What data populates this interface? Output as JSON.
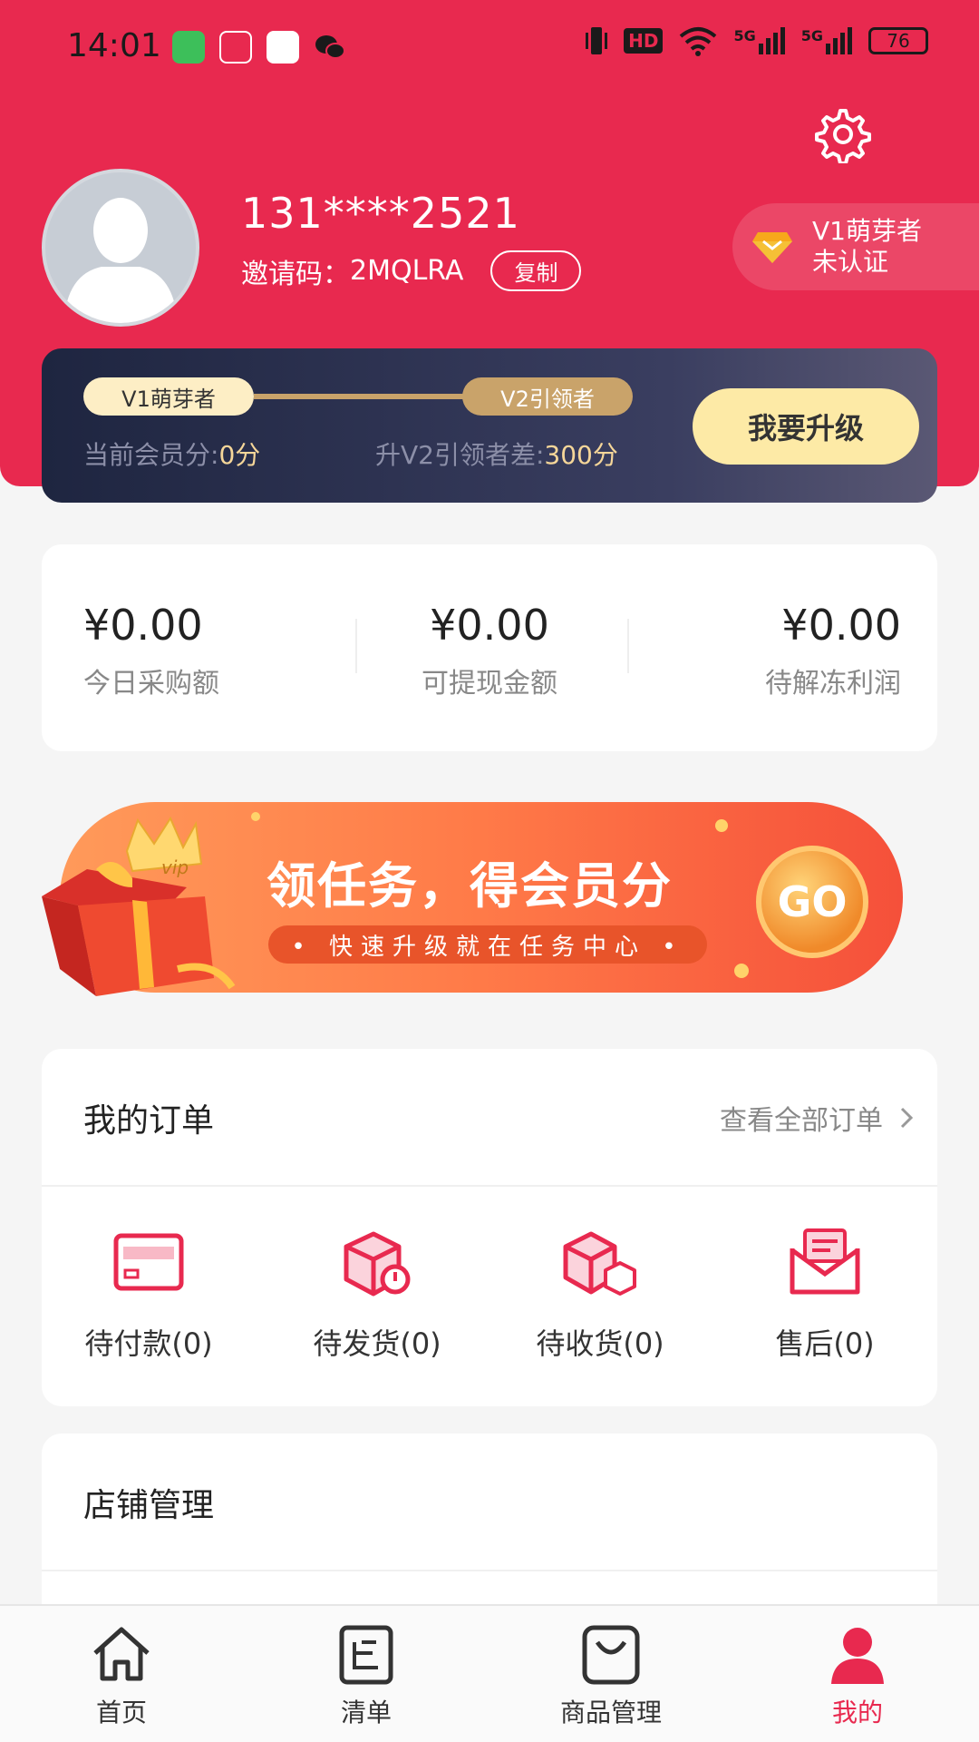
{
  "status_bar": {
    "time": "14:01",
    "signal_1": "5G",
    "signal_2": "5G",
    "hd": "HD",
    "battery": "76"
  },
  "profile": {
    "phone": "131****2521",
    "invite_label": "邀请码：",
    "invite_code": "2MQLRA",
    "copy_label": "复制",
    "badge_level": "V1萌芽者",
    "badge_status": "未认证"
  },
  "level": {
    "current": "V1萌芽者",
    "next": "V2引领者",
    "current_score_label": "当前会员分:",
    "current_score": "0分",
    "diff_label": "升V2引领者差:",
    "diff_score": "300分",
    "upgrade_label": "我要升级"
  },
  "money": [
    {
      "value": "¥0.00",
      "label": "今日采购额"
    },
    {
      "value": "¥0.00",
      "label": "可提现金额"
    },
    {
      "value": "¥0.00",
      "label": "待解冻利润"
    }
  ],
  "banner": {
    "title": "领任务，得会员分",
    "subtitle": "• 快速升级就在任务中心 •",
    "go": "GO",
    "badge": "vip"
  },
  "orders": {
    "title": "我的订单",
    "view_all": "查看全部订单",
    "items": [
      {
        "label": "待付款(0)",
        "icon": "card-icon"
      },
      {
        "label": "待发货(0)",
        "icon": "box-clock-icon"
      },
      {
        "label": "待收货(0)",
        "icon": "boxes-icon"
      },
      {
        "label": "售后(0)",
        "icon": "envelope-icon"
      }
    ]
  },
  "store": {
    "title": "店铺管理"
  },
  "tabs": [
    {
      "label": "首页",
      "icon": "home-icon"
    },
    {
      "label": "清单",
      "icon": "list-icon"
    },
    {
      "label": "商品管理",
      "icon": "bag-icon"
    },
    {
      "label": "我的",
      "icon": "user-icon"
    }
  ],
  "colors": {
    "primary": "#e8294f",
    "gold": "#c9a36a",
    "dark_card": "#1e2540"
  }
}
